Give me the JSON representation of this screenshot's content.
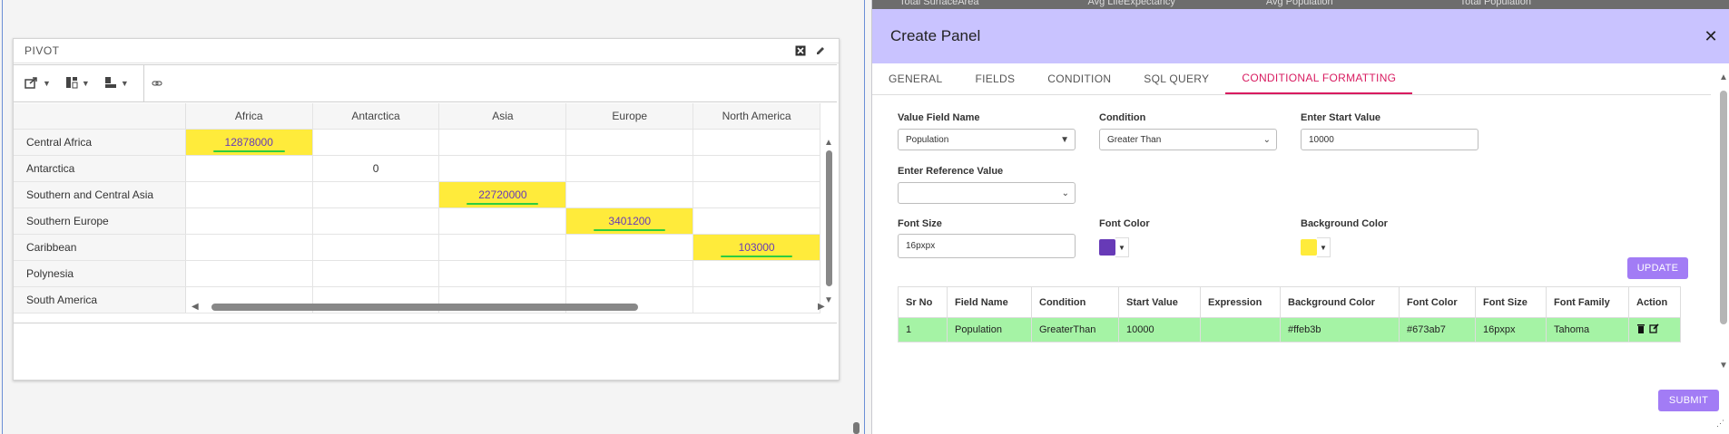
{
  "pivot": {
    "title": "PIVOT",
    "columns": [
      "Africa",
      "Antarctica",
      "Asia",
      "Europe",
      "North America"
    ],
    "rows": [
      {
        "label": "Central Africa",
        "values": [
          "12878000",
          "",
          "",
          "",
          ""
        ],
        "highlight": 0
      },
      {
        "label": "Antarctica",
        "values": [
          "",
          "0",
          "",
          "",
          ""
        ],
        "highlight": -1
      },
      {
        "label": "Southern and Central Asia",
        "values": [
          "",
          "",
          "22720000",
          "",
          ""
        ],
        "highlight": 2
      },
      {
        "label": "Southern Europe",
        "values": [
          "",
          "",
          "",
          "3401200",
          ""
        ],
        "highlight": 3
      },
      {
        "label": "Caribbean",
        "values": [
          "",
          "",
          "",
          "",
          "103000"
        ],
        "highlight": 4
      },
      {
        "label": "Polynesia",
        "values": [
          "",
          "",
          "",
          "",
          ""
        ],
        "highlight": -1
      },
      {
        "label": "South America",
        "values": [
          "",
          "",
          "",
          "",
          ""
        ],
        "highlight": -1
      }
    ]
  },
  "bg_tabs": [
    "Total SurfaceArea",
    "Avg LifeExpectancy",
    "Avg Population",
    "Total Population"
  ],
  "panel": {
    "title": "Create Panel",
    "close": "✕",
    "tabs": [
      "GENERAL",
      "FIELDS",
      "CONDITION",
      "SQL QUERY",
      "CONDITIONAL FORMATTING"
    ],
    "active_tab": "CONDITIONAL FORMATTING",
    "form": {
      "value_field_label": "Value Field Name",
      "value_field": "Population",
      "condition_label": "Condition",
      "condition": "Greater Than",
      "start_value_label": "Enter Start Value",
      "start_value": "10000",
      "reference_label": "Enter Reference Value",
      "reference_value": "",
      "font_size_label": "Font Size",
      "font_size": "16pxpx",
      "font_color_label": "Font Color",
      "font_color": "#673ab7",
      "bg_color_label": "Background Color",
      "bg_color": "#ffeb3b"
    },
    "update_label": "UPDATE",
    "submit_label": "SUBMIT",
    "table": {
      "headers": [
        "Sr No",
        "Field Name",
        "Condition",
        "Start Value",
        "Expression",
        "Background Color",
        "Font Color",
        "Font Size",
        "Font Family",
        "Action"
      ],
      "rows": [
        [
          "1",
          "Population",
          "GreaterThan",
          "10000",
          "",
          "#ffeb3b",
          "#673ab7",
          "16pxpx",
          "Tahoma",
          ""
        ]
      ]
    }
  },
  "colors": {
    "accent": "#d81b60",
    "header_bg": "#c9c3ff",
    "button": "#a27cf5",
    "highlight_bg": "#ffeb3b",
    "highlight_text": "#673ab7",
    "row_green": "#a5f3a5"
  }
}
